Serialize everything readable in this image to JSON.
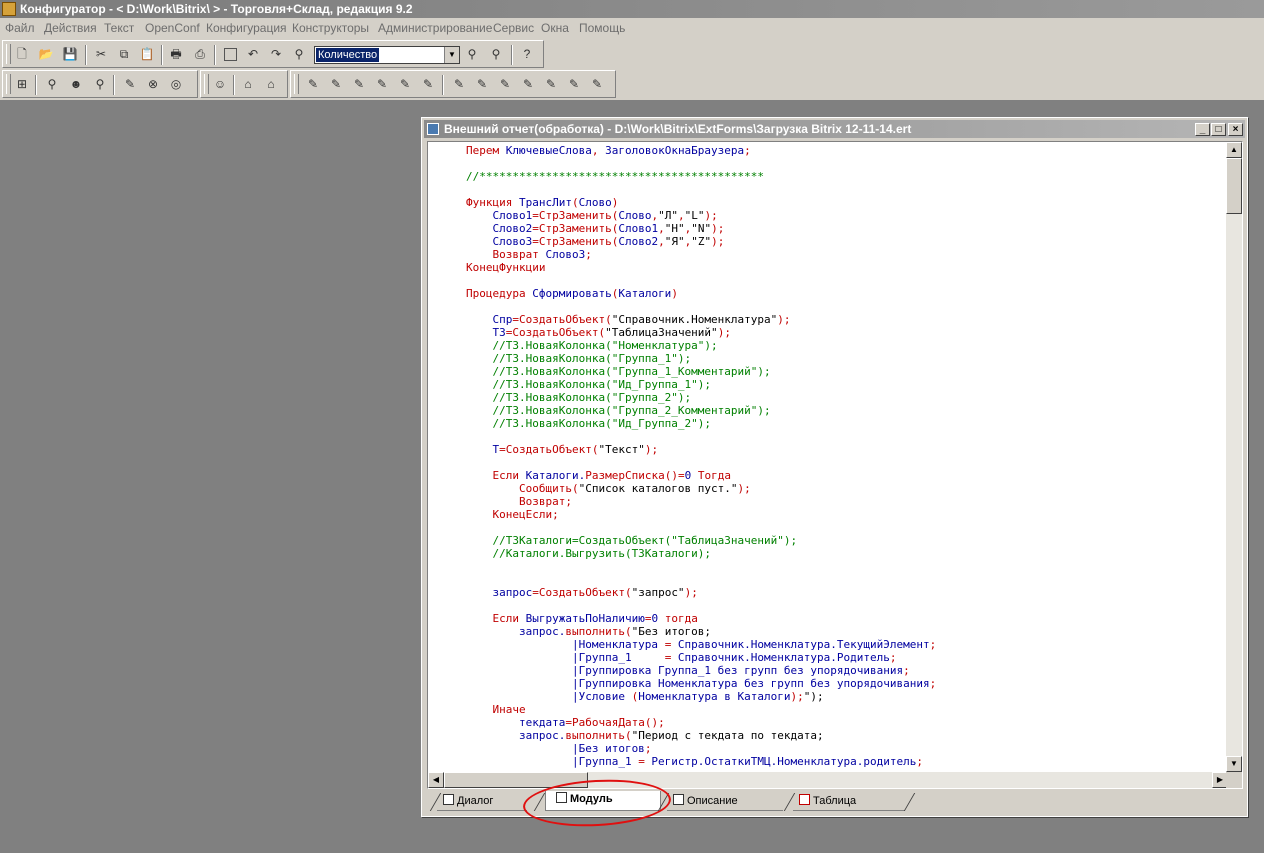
{
  "app": {
    "title": "Конфигуратор - < D:\\Work\\Bitrix\\ > - Торговля+Склад, редакция 9.2"
  },
  "menu": [
    "Файл",
    "Действия",
    "Текст",
    "OpenConf",
    "Конфигурация",
    "Конструкторы",
    "Администрирование",
    "Сервис",
    "Окна",
    "Помощь"
  ],
  "toolbar": {
    "search_value": "Количество",
    "icons": {
      "new": "new-document-icon",
      "open": "open-folder-icon",
      "save": "save-icon",
      "cut": "cut-icon",
      "copy": "copy-icon",
      "paste": "paste-icon",
      "print": "print-icon",
      "preview": "print-preview-icon",
      "undo": "undo-icon",
      "redo": "redo-icon",
      "find": "binoculars-icon",
      "help": "help-icon"
    }
  },
  "window": {
    "title": "Внешний отчет(обработка) - D:\\Work\\Bitrix\\ExtForms\\Загрузка Bitrix 12-11-14.ert",
    "minimize": "_",
    "maximize": "□",
    "close": "×"
  },
  "tabs": [
    {
      "label": "Диалог",
      "icon": "dialog-icon"
    },
    {
      "label": "Модуль",
      "icon": "module-icon",
      "active": true
    },
    {
      "label": "Описание",
      "icon": "description-icon"
    },
    {
      "label": "Таблица",
      "icon": "table-icon"
    }
  ],
  "colors": {
    "keyword": "#c00000",
    "comment": "#008000",
    "function": "#0000a0",
    "annotation": "#e01010"
  },
  "code_lines": [
    "Перем КлючевыеСлова, ЗаголовокОкнаБраузера;",
    "",
    "//*******************************************",
    "",
    "Функция ТрансЛит(Слово)",
    "    Слово1=СтрЗаменить(Слово,\"Л\",\"L\");",
    "    Слово2=СтрЗаменить(Слово1,\"Н\",\"N\");",
    "    Слово3=СтрЗаменить(Слово2,\"Я\",\"Z\");",
    "    Возврат Слово3;",
    "КонецФункции",
    "",
    "Процедура Сформировать(Каталоги)",
    "",
    "    Спр=СоздатьОбъект(\"Справочник.Номенклатура\");",
    "    ТЗ=СоздатьОбъект(\"ТаблицаЗначений\");",
    "    //ТЗ.НоваяКолонка(\"Номенклатура\");",
    "    //ТЗ.НоваяКолонка(\"Группа_1\");",
    "    //ТЗ.НоваяКолонка(\"Группа_1_Комментарий\");",
    "    //ТЗ.НоваяКолонка(\"Ид_Группа_1\");",
    "    //ТЗ.НоваяКолонка(\"Группа_2\");",
    "    //ТЗ.НоваяКолонка(\"Группа_2_Комментарий\");",
    "    //ТЗ.НоваяКолонка(\"Ид_Группа_2\");",
    "",
    "    Т=СоздатьОбъект(\"Текст\");",
    "",
    "    Если Каталоги.РазмерСписка()=0 Тогда",
    "        Сообщить(\"Список каталогов пуст.\");",
    "        Возврат;",
    "    КонецЕсли;",
    "",
    "    //ТЗКаталоги=СоздатьОбъект(\"ТаблицаЗначений\");",
    "    //Каталоги.Выгрузить(ТЗКаталоги);",
    "",
    "",
    "    запрос=СоздатьОбъект(\"запрос\");",
    "",
    "    Если ВыгружатьПоНаличию=0 тогда",
    "        запрос.выполнить(\"Без итогов;",
    "                |Номенклатура = Справочник.Номенклатура.ТекущийЭлемент;",
    "                |Группа_1     = Справочник.Номенклатура.Родитель;",
    "                |Группировка Группа_1 без групп без упорядочивания;",
    "                |Группировка Номенклатура без групп без упорядочивания;",
    "                |Условие (Номенклатура в Каталоги);\");",
    "    Иначе",
    "        текдата=РабочаяДата();",
    "        запрос.выполнить(\"Период с текдата по текдата;",
    "                |Без итогов;",
    "                |Группа_1 = Регистр.ОстаткиТМЦ.Номенклатура.родитель;"
  ]
}
